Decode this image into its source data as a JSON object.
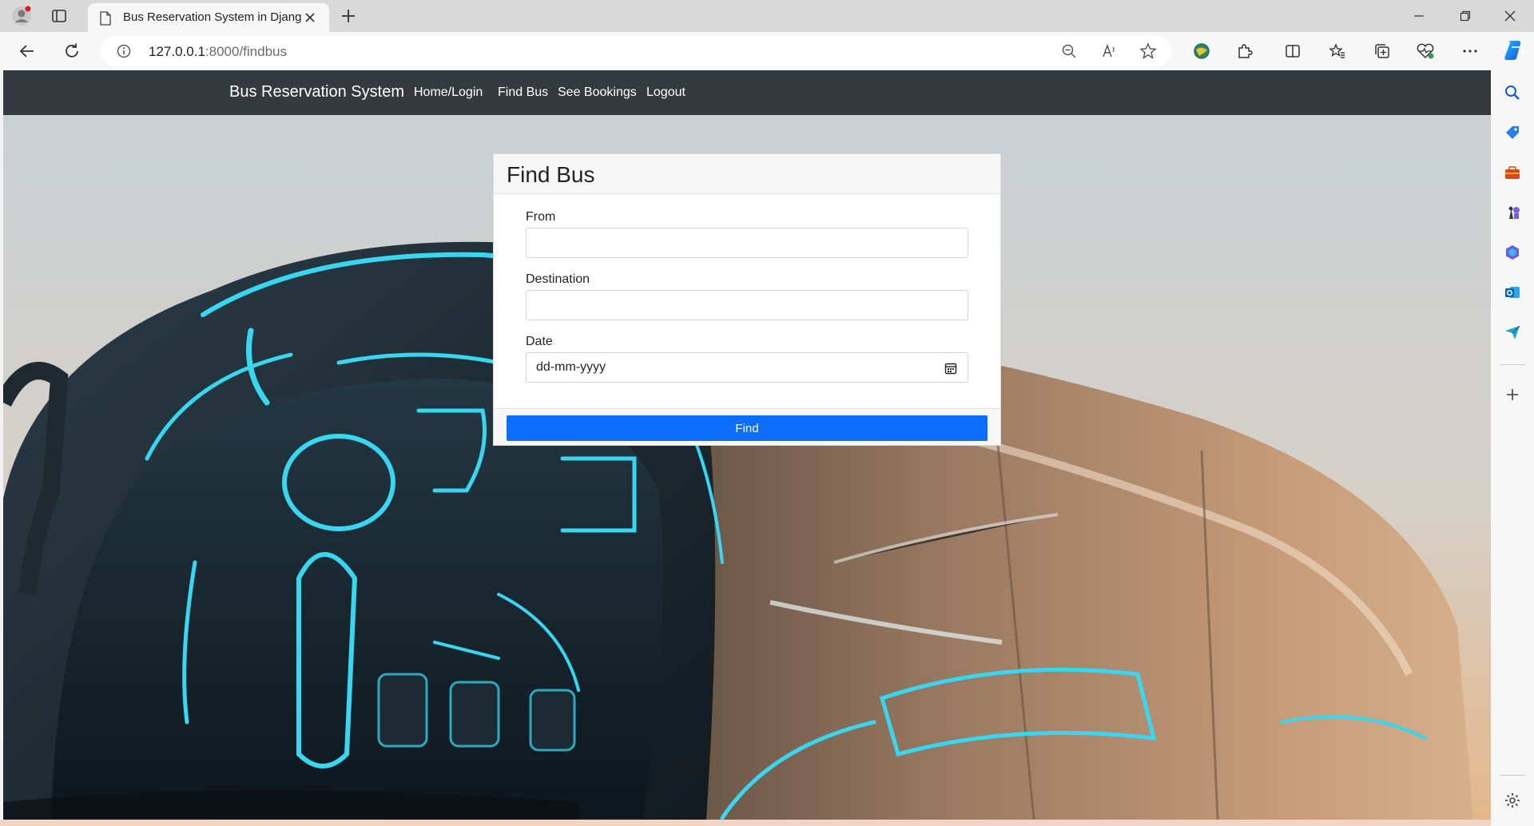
{
  "browser": {
    "tab_title": "Bus Reservation System in Djang",
    "url_host": "127.0.0.1",
    "url_path": ":8000/findbus"
  },
  "navbar": {
    "brand": "Bus Reservation System",
    "links": [
      "Home/Login",
      "Find Bus",
      "See Bookings",
      "Logout"
    ]
  },
  "form": {
    "title": "Find Bus",
    "from_label": "From",
    "from_value": "",
    "destination_label": "Destination",
    "destination_value": "",
    "date_label": "Date",
    "date_placeholder": "dd-mm-yyyy",
    "submit_label": "Find"
  },
  "colors": {
    "navbar_bg": "#343a40",
    "button_primary": "#0d6efd",
    "accent_neon": "#38d6f0"
  },
  "icons": {
    "toolbar": [
      "back-icon",
      "refresh-icon",
      "info-icon",
      "zoom-out-icon",
      "read-aloud-icon",
      "favorite-star-icon",
      "extension-globe-icon",
      "extensions-icon",
      "split-screen-icon",
      "favorites-icon",
      "collections-icon",
      "browser-essentials-icon",
      "more-icon",
      "copilot-icon"
    ],
    "sidebar": [
      "search-icon",
      "shopping-tag-icon",
      "tools-icon",
      "games-icon",
      "microsoft-365-icon",
      "outlook-icon",
      "send-icon",
      "add-icon",
      "settings-icon"
    ]
  }
}
